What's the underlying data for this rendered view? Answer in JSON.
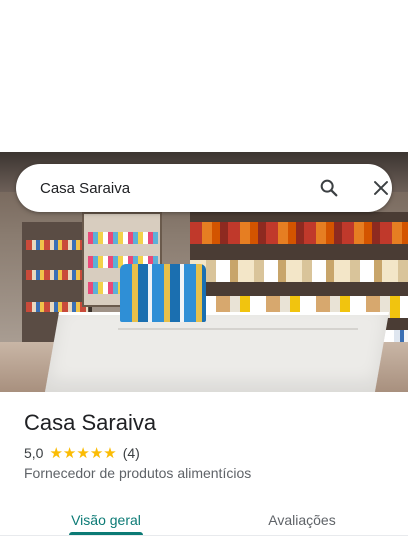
{
  "search": {
    "query": "Casa Saraiva",
    "search_icon": "search-icon",
    "close_icon": "close-icon"
  },
  "place": {
    "name": "Casa Saraiva",
    "rating": "5,0",
    "stars": 5,
    "star_color": "#fbbc04",
    "reviews_count": "(4)",
    "category": "Fornecedor de produtos alimentícios"
  },
  "tabs": [
    {
      "label": "Visão geral",
      "selected": true
    },
    {
      "label": "Avaliações",
      "selected": false
    }
  ],
  "colors": {
    "accent": "#0b7a75",
    "text_primary": "#202124",
    "text_secondary": "#5f6368"
  }
}
